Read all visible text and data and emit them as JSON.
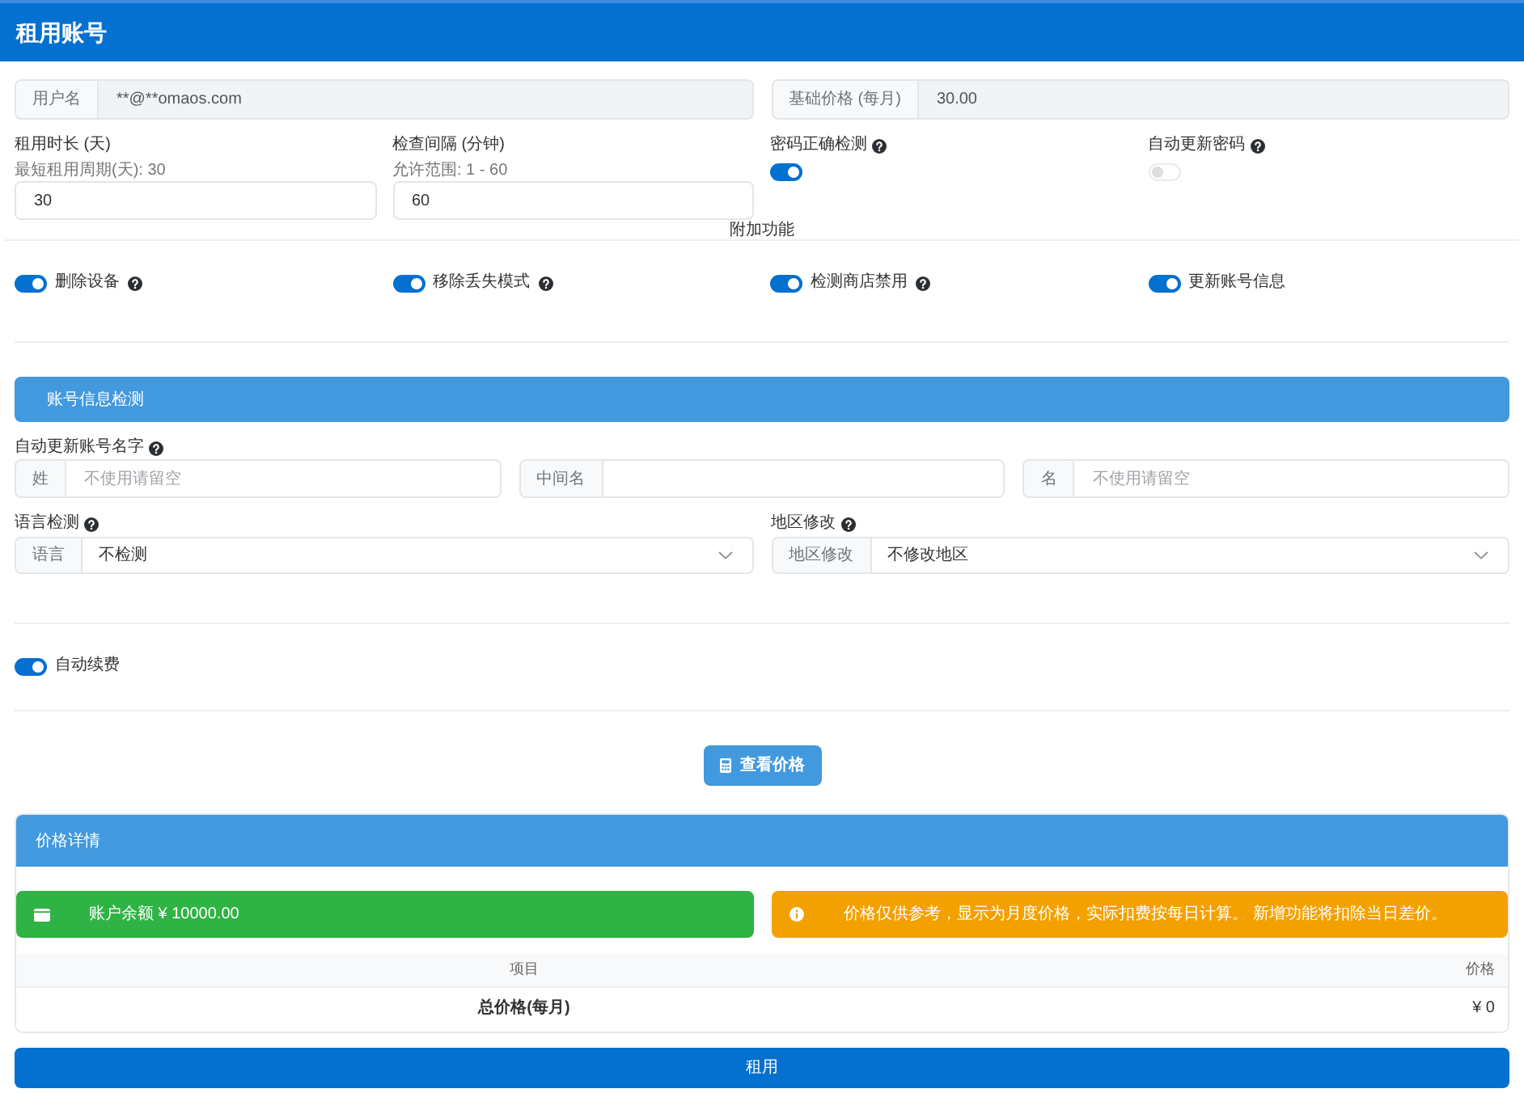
{
  "header": {
    "title": "租用账号"
  },
  "info_fields": [
    {
      "label": "用户名",
      "value": "**@**omaos.com",
      "disabled": true
    },
    {
      "label": "基础价格 (每月)",
      "value": "30.00",
      "disabled": true
    }
  ],
  "settings": [
    {
      "kind": "number",
      "label": "租用时长 (天)",
      "hint": "最短租用周期(天): 30",
      "value": "30"
    },
    {
      "kind": "number",
      "label": "检查间隔 (分钟)",
      "hint": "允许范围: 1 - 60",
      "value": "60"
    },
    {
      "kind": "toggle",
      "label": "密码正确检测",
      "help": true,
      "on": true,
      "disabled": false
    },
    {
      "kind": "toggle",
      "label": "自动更新密码",
      "help": true,
      "on": false,
      "disabled": true
    }
  ],
  "extras": {
    "title": "附加功能",
    "options": [
      {
        "label": "删除设备",
        "help": true,
        "on": true
      },
      {
        "label": "移除丢失模式",
        "help": true,
        "on": true
      },
      {
        "label": "检测商店禁用",
        "help": true,
        "on": true
      },
      {
        "label": "更新账号信息",
        "help": false,
        "on": true
      }
    ]
  },
  "account_check": {
    "title": "账号信息检测",
    "name_label": "自动更新账号名字",
    "name_help": true,
    "name_fields": [
      {
        "label": "姓",
        "placeholder": "不使用请留空"
      },
      {
        "label": "中间名"
      },
      {
        "label": "名",
        "placeholder": "不使用请留空"
      }
    ],
    "selects": [
      {
        "label": "语言检测",
        "help": true,
        "prefix": "语言",
        "value": "不检测"
      },
      {
        "label": "地区修改",
        "help": true,
        "prefix": "地区修改",
        "value": "不修改地区"
      }
    ]
  },
  "auto_renew": {
    "label": "自动续费",
    "on": true
  },
  "check_price_button": {
    "label": "查看价格"
  },
  "price_details": {
    "title": "价格详情",
    "alerts": [
      {
        "kind": "success",
        "text": "账户余额 ¥ 10000.00"
      },
      {
        "kind": "warning",
        "text": "价格仅供参考，显示为月度价格，实际扣费按每日计算。 新增功能将扣除当日差价。"
      }
    ],
    "table": {
      "columns": [
        "项目",
        "价格"
      ],
      "rows": [
        [
          "总价格(每月)",
          "¥ 0"
        ]
      ]
    }
  },
  "rent_button": {
    "label": "租用"
  }
}
